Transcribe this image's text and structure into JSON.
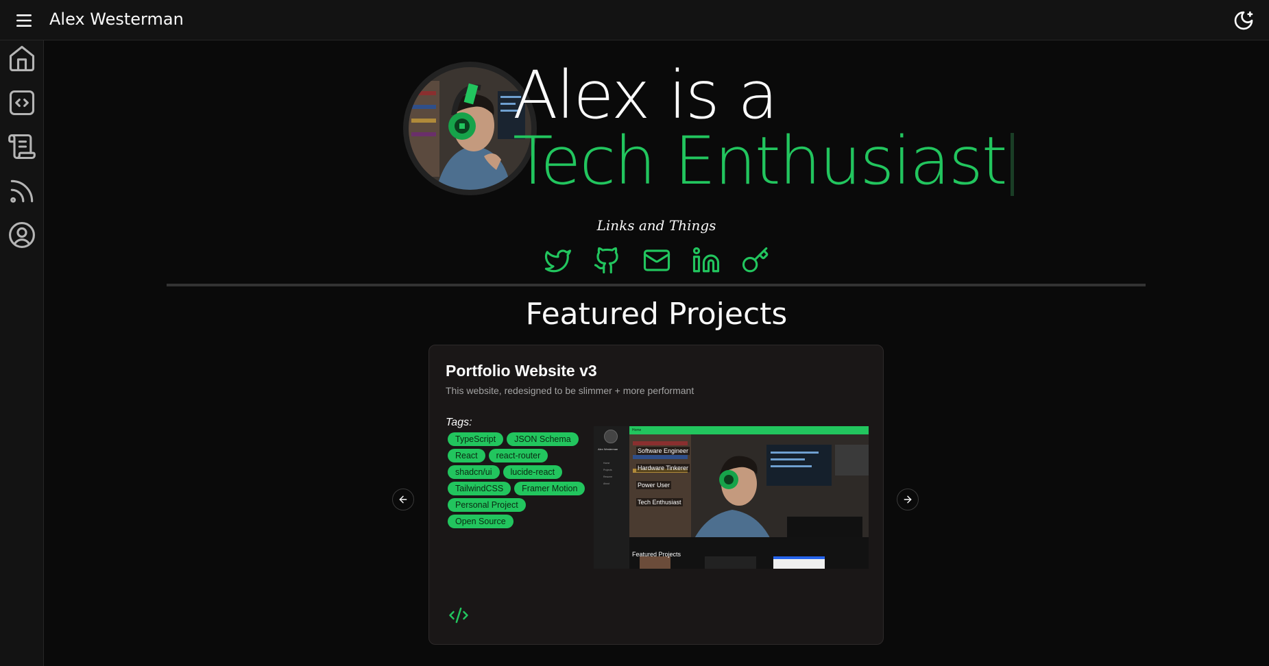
{
  "header": {
    "title": "Alex Westerman"
  },
  "sidebar": {
    "items": [
      {
        "icon": "home-icon",
        "label": "Home"
      },
      {
        "icon": "code-icon",
        "label": "Projects"
      },
      {
        "icon": "scroll-icon",
        "label": "Resume"
      },
      {
        "icon": "rss-icon",
        "label": "Blog"
      },
      {
        "icon": "user-icon",
        "label": "About"
      }
    ]
  },
  "hero": {
    "line1": "Alex is a",
    "line2": "Tech Enthusiast"
  },
  "links": {
    "title": "Links and Things",
    "icons": [
      "twitter-icon",
      "github-icon",
      "mail-icon",
      "linkedin-icon",
      "key-icon"
    ]
  },
  "featured": {
    "title": "Featured Projects",
    "project": {
      "name": "Portfolio Website v3",
      "description": "This website, redesigned to be slimmer + more performant",
      "tags_label": "Tags:",
      "tags": [
        "TypeScript",
        "JSON Schema",
        "React",
        "react-router",
        "shadcn/ui",
        "lucide-react",
        "TailwindCSS",
        "Framer Motion",
        "Personal Project",
        "Open Source"
      ],
      "screenshot": {
        "topbar": "Home",
        "name": "Alex Westerman",
        "menu": [
          "Home",
          "Projects",
          "Resume",
          "About"
        ],
        "rotating": [
          "Software Engineer",
          "Hardware Tinkerer",
          "Power User",
          "Tech Enthusiast"
        ],
        "featured": "Featured Projects"
      }
    }
  },
  "colors": {
    "accent": "#22c55e",
    "background": "#0a0a0a",
    "panel": "#131313",
    "card": "#1a1717"
  }
}
